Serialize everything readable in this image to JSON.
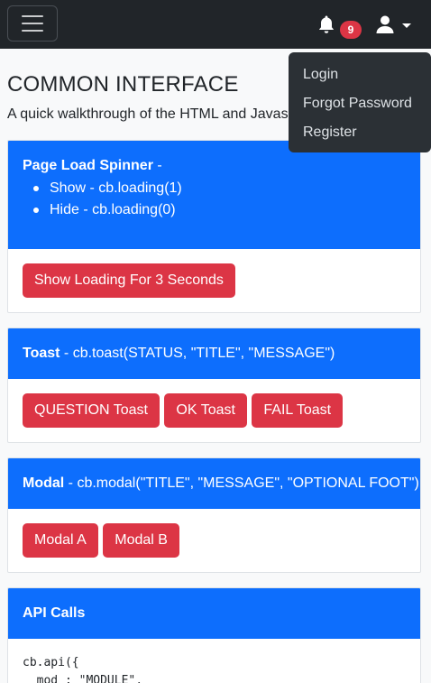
{
  "navbar": {
    "menu_icon": "hamburger-icon",
    "notifications": {
      "icon": "bell-icon",
      "count": "9"
    },
    "user_icon": "user-icon",
    "dropdown": [
      "Login",
      "Forgot Password",
      "Register"
    ]
  },
  "page": {
    "title": "COMMON INTERFACE",
    "description": "A quick walkthrough of the HTML and Javascript"
  },
  "cards": {
    "spinner": {
      "title": "Page Load Spinner",
      "suffix": " -",
      "items": [
        "Show - cb.loading(1)",
        "Hide - cb.loading(0)"
      ],
      "button": "Show Loading For 3 Seconds"
    },
    "toast": {
      "title": "Toast",
      "suffix": " - cb.toast(STATUS, \"TITLE\", \"MESSAGE\")",
      "buttons": [
        "QUESTION Toast",
        "OK Toast",
        "FAIL Toast"
      ]
    },
    "modal": {
      "title": "Modal",
      "suffix": " - cb.modal(\"TITLE\", \"MESSAGE\", \"OPTIONAL FOOT\")",
      "buttons": [
        "Modal A",
        "Modal B"
      ]
    },
    "api": {
      "title": "API Calls",
      "code_lines": [
        "cb.api({",
        "  mod : \"MODULE\","
      ]
    }
  },
  "colors": {
    "navbar": "#212529",
    "primary": "#0d6efd",
    "danger": "#dc3545"
  }
}
